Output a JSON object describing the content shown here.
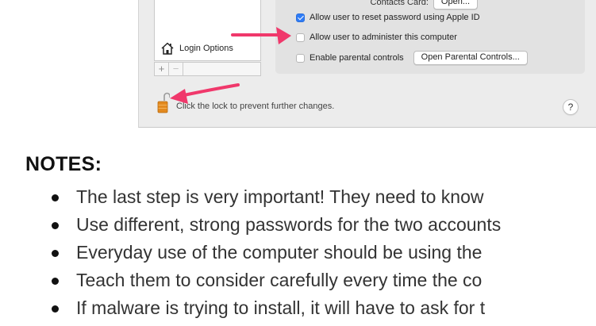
{
  "window": {
    "contacts_card_label": "Contacts Card:",
    "contacts_open_button": "Open...",
    "checkbox_reset_password": {
      "label": "Allow user to reset password using Apple ID",
      "checked": true
    },
    "checkbox_administer": {
      "label": "Allow user to administer this computer",
      "checked": false
    },
    "checkbox_parental": {
      "label": "Enable parental controls",
      "checked": false
    },
    "open_parental_controls_button": "Open Parental Controls...",
    "login_options_label": "Login Options",
    "add_button": "+",
    "remove_button": "−",
    "lock_text": "Click the lock to prevent further changes.",
    "help_button": "?",
    "icons": [
      "house-icon",
      "unlocked-padlock-icon",
      "arrow-annotation-icon"
    ],
    "accent_color": "#2f7cf6",
    "annotation_color": "#f0386b"
  },
  "notes": {
    "heading": "NOTES:",
    "items": [
      "The last step is very important! They need to know",
      "Use different, strong passwords for the two accounts",
      "Everyday use of the computer should be using the",
      "Teach them to consider carefully every time the co",
      "If malware is trying to install, it will have to ask for t"
    ]
  }
}
